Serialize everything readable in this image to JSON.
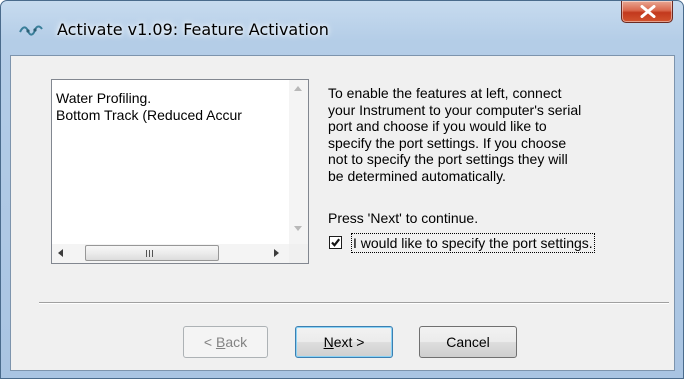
{
  "window": {
    "title": "Activate v1.09: Feature Activation",
    "close_icon": "close-x-icon",
    "app_icon": "activate-app-icon"
  },
  "features": {
    "items": [
      "Water Profiling.",
      "Bottom Track (Reduced Accur"
    ]
  },
  "instructions": {
    "lines": [
      "To enable the features at left, connect",
      "your Instrument to your computer's serial",
      "port and choose if you would like to",
      "specify the port settings. If you choose",
      "not to specify the port settings they will",
      "be determined automatically."
    ],
    "press_next": "Press 'Next' to continue."
  },
  "port_settings": {
    "label": "I would like to specify the port settings.",
    "checked": true
  },
  "buttons": {
    "back": {
      "mnemonic": "B",
      "rest": "ack",
      "prefix": "< ",
      "enabled": false
    },
    "next": {
      "mnemonic": "N",
      "rest": "ext >",
      "enabled": true
    },
    "cancel": {
      "label": "Cancel",
      "enabled": true
    }
  },
  "colors": {
    "title_close": "#c7432a",
    "accent_focus": "#3c7fb1"
  }
}
